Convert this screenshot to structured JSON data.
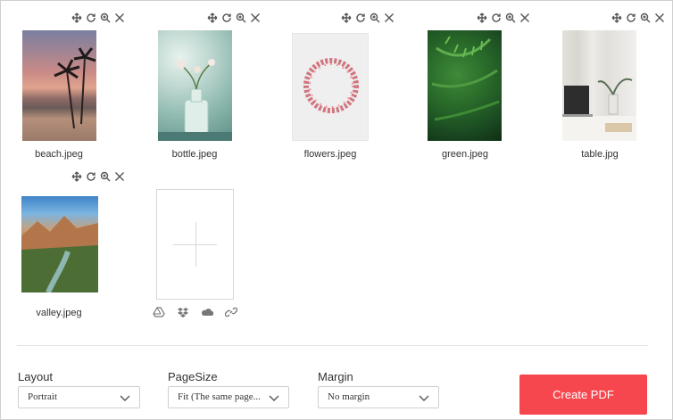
{
  "images": [
    {
      "name": "beach.jpeg",
      "kind": "beach"
    },
    {
      "name": "bottle.jpeg",
      "kind": "bottle"
    },
    {
      "name": "flowers.jpeg",
      "kind": "flowers"
    },
    {
      "name": "green.jpeg",
      "kind": "green"
    },
    {
      "name": "table.jpg",
      "kind": "table"
    },
    {
      "name": "valley.jpeg",
      "kind": "valley"
    }
  ],
  "card_tools": [
    "move-icon",
    "rotate-icon",
    "zoom-icon",
    "close-icon"
  ],
  "upload_sources": [
    "google-drive-icon",
    "dropbox-icon",
    "onedrive-icon",
    "link-icon"
  ],
  "options": {
    "layout": {
      "label": "Layout",
      "value": "Portrait"
    },
    "pagesize": {
      "label": "PageSize",
      "value": "Fit (The same page..."
    },
    "margin": {
      "label": "Margin",
      "value": "No margin"
    }
  },
  "create_button": {
    "label": "Create PDF",
    "color": "#f6474f"
  }
}
